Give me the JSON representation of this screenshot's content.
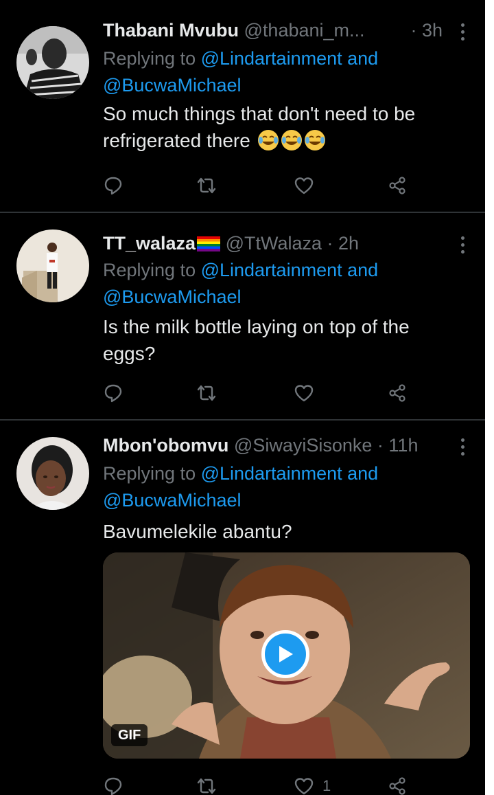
{
  "colors": {
    "background": "#000000",
    "text": "#e7e9ea",
    "muted": "#71767b",
    "link": "#1d9bf0",
    "separator": "#2f3336"
  },
  "tweets": [
    {
      "name": "Thabani Mvubu",
      "handle": "@thabani_m...",
      "time": "· 3h",
      "reply_prefix": "Replying to ",
      "reply_link1": "@Lindartainment and",
      "reply_link2": "@BucwaMichael",
      "text_line1": "So much things that don't need to be",
      "text_line2": "refrigerated there",
      "emoji": [
        "face-with-tears-of-joy",
        "face-with-tears-of-joy",
        "face-with-tears-of-joy"
      ],
      "like_count": ""
    },
    {
      "name": "TT_walaza",
      "name_flag": "rainbow-flag",
      "handle": "@TtWalaza",
      "time": "· 2h",
      "reply_prefix": "Replying to ",
      "reply_link1": "@Lindartainment and",
      "reply_link2": "@BucwaMichael",
      "text_line1": "Is the milk bottle laying on top of the",
      "text_line2": "eggs?",
      "like_count": ""
    },
    {
      "name": "Mbon'obomvu",
      "handle": "@SiwayiSisonke",
      "time": "· 11h",
      "reply_prefix": "Replying to ",
      "reply_link1": "@Lindartainment and",
      "reply_link2": "@BucwaMichael",
      "text_line1": "Bavumelekile abantu?",
      "media_badge": "GIF",
      "like_count": "1"
    }
  ],
  "icons": {
    "reply": "reply-icon",
    "retweet": "retweet-icon",
    "like": "heart-icon",
    "share": "share-icon",
    "more": "more-vertical-icon",
    "play": "play-icon"
  }
}
